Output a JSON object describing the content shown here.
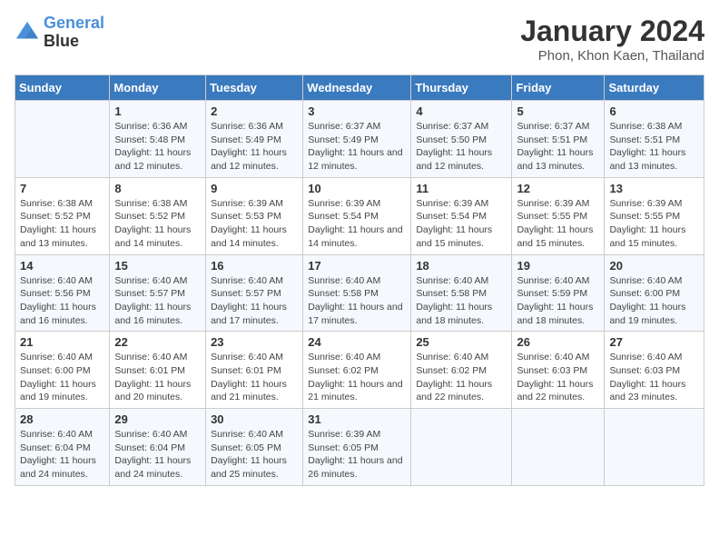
{
  "header": {
    "logo_line1": "General",
    "logo_line2": "Blue",
    "month": "January 2024",
    "location": "Phon, Khon Kaen, Thailand"
  },
  "days_of_week": [
    "Sunday",
    "Monday",
    "Tuesday",
    "Wednesday",
    "Thursday",
    "Friday",
    "Saturday"
  ],
  "weeks": [
    [
      {
        "num": "",
        "info": ""
      },
      {
        "num": "1",
        "info": "Sunrise: 6:36 AM\nSunset: 5:48 PM\nDaylight: 11 hours and 12 minutes."
      },
      {
        "num": "2",
        "info": "Sunrise: 6:36 AM\nSunset: 5:49 PM\nDaylight: 11 hours and 12 minutes."
      },
      {
        "num": "3",
        "info": "Sunrise: 6:37 AM\nSunset: 5:49 PM\nDaylight: 11 hours and 12 minutes."
      },
      {
        "num": "4",
        "info": "Sunrise: 6:37 AM\nSunset: 5:50 PM\nDaylight: 11 hours and 12 minutes."
      },
      {
        "num": "5",
        "info": "Sunrise: 6:37 AM\nSunset: 5:51 PM\nDaylight: 11 hours and 13 minutes."
      },
      {
        "num": "6",
        "info": "Sunrise: 6:38 AM\nSunset: 5:51 PM\nDaylight: 11 hours and 13 minutes."
      }
    ],
    [
      {
        "num": "7",
        "info": "Sunrise: 6:38 AM\nSunset: 5:52 PM\nDaylight: 11 hours and 13 minutes."
      },
      {
        "num": "8",
        "info": "Sunrise: 6:38 AM\nSunset: 5:52 PM\nDaylight: 11 hours and 14 minutes."
      },
      {
        "num": "9",
        "info": "Sunrise: 6:39 AM\nSunset: 5:53 PM\nDaylight: 11 hours and 14 minutes."
      },
      {
        "num": "10",
        "info": "Sunrise: 6:39 AM\nSunset: 5:54 PM\nDaylight: 11 hours and 14 minutes."
      },
      {
        "num": "11",
        "info": "Sunrise: 6:39 AM\nSunset: 5:54 PM\nDaylight: 11 hours and 15 minutes."
      },
      {
        "num": "12",
        "info": "Sunrise: 6:39 AM\nSunset: 5:55 PM\nDaylight: 11 hours and 15 minutes."
      },
      {
        "num": "13",
        "info": "Sunrise: 6:39 AM\nSunset: 5:55 PM\nDaylight: 11 hours and 15 minutes."
      }
    ],
    [
      {
        "num": "14",
        "info": "Sunrise: 6:40 AM\nSunset: 5:56 PM\nDaylight: 11 hours and 16 minutes."
      },
      {
        "num": "15",
        "info": "Sunrise: 6:40 AM\nSunset: 5:57 PM\nDaylight: 11 hours and 16 minutes."
      },
      {
        "num": "16",
        "info": "Sunrise: 6:40 AM\nSunset: 5:57 PM\nDaylight: 11 hours and 17 minutes."
      },
      {
        "num": "17",
        "info": "Sunrise: 6:40 AM\nSunset: 5:58 PM\nDaylight: 11 hours and 17 minutes."
      },
      {
        "num": "18",
        "info": "Sunrise: 6:40 AM\nSunset: 5:58 PM\nDaylight: 11 hours and 18 minutes."
      },
      {
        "num": "19",
        "info": "Sunrise: 6:40 AM\nSunset: 5:59 PM\nDaylight: 11 hours and 18 minutes."
      },
      {
        "num": "20",
        "info": "Sunrise: 6:40 AM\nSunset: 6:00 PM\nDaylight: 11 hours and 19 minutes."
      }
    ],
    [
      {
        "num": "21",
        "info": "Sunrise: 6:40 AM\nSunset: 6:00 PM\nDaylight: 11 hours and 19 minutes."
      },
      {
        "num": "22",
        "info": "Sunrise: 6:40 AM\nSunset: 6:01 PM\nDaylight: 11 hours and 20 minutes."
      },
      {
        "num": "23",
        "info": "Sunrise: 6:40 AM\nSunset: 6:01 PM\nDaylight: 11 hours and 21 minutes."
      },
      {
        "num": "24",
        "info": "Sunrise: 6:40 AM\nSunset: 6:02 PM\nDaylight: 11 hours and 21 minutes."
      },
      {
        "num": "25",
        "info": "Sunrise: 6:40 AM\nSunset: 6:02 PM\nDaylight: 11 hours and 22 minutes."
      },
      {
        "num": "26",
        "info": "Sunrise: 6:40 AM\nSunset: 6:03 PM\nDaylight: 11 hours and 22 minutes."
      },
      {
        "num": "27",
        "info": "Sunrise: 6:40 AM\nSunset: 6:03 PM\nDaylight: 11 hours and 23 minutes."
      }
    ],
    [
      {
        "num": "28",
        "info": "Sunrise: 6:40 AM\nSunset: 6:04 PM\nDaylight: 11 hours and 24 minutes."
      },
      {
        "num": "29",
        "info": "Sunrise: 6:40 AM\nSunset: 6:04 PM\nDaylight: 11 hours and 24 minutes."
      },
      {
        "num": "30",
        "info": "Sunrise: 6:40 AM\nSunset: 6:05 PM\nDaylight: 11 hours and 25 minutes."
      },
      {
        "num": "31",
        "info": "Sunrise: 6:39 AM\nSunset: 6:05 PM\nDaylight: 11 hours and 26 minutes."
      },
      {
        "num": "",
        "info": ""
      },
      {
        "num": "",
        "info": ""
      },
      {
        "num": "",
        "info": ""
      }
    ]
  ]
}
